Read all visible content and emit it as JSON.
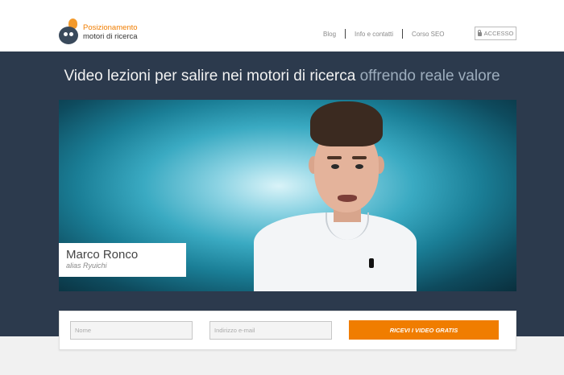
{
  "header": {
    "logo": {
      "line1": "Posizionamento",
      "line2": "motori di ricerca",
      "icon": "robot-bulb-logo"
    },
    "nav": [
      {
        "label": "Blog"
      },
      {
        "label": "Info e contatti"
      },
      {
        "label": "Corso SEO"
      }
    ],
    "login_label": "ACCESSO",
    "login_icon": "lock-icon"
  },
  "hero": {
    "headline_main": "Video lezioni per salire nei motori di ricerca",
    "headline_accent": "offrendo reale valore",
    "presenter": {
      "name": "Marco Ronco",
      "alias": "alias Ryuichi"
    }
  },
  "form": {
    "name_placeholder": "Nome",
    "email_placeholder": "Indirizzo e-mail",
    "submit_label": "RICEVI I VIDEO GRATIS"
  },
  "colors": {
    "brand_orange": "#f07d00",
    "hero_bg": "#2c3a4d",
    "headline_accent": "#9dadbd"
  }
}
